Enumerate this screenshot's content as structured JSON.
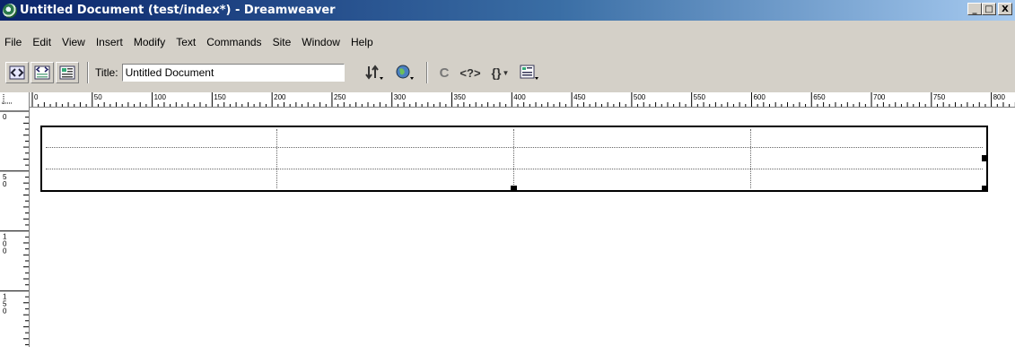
{
  "window": {
    "title": "Untitled Document (test/index*) - Dreamweaver",
    "controls": [
      "_",
      "□",
      "X"
    ]
  },
  "menu": [
    "File",
    "Edit",
    "View",
    "Insert",
    "Modify",
    "Text",
    "Commands",
    "Site",
    "Window",
    "Help"
  ],
  "toolbar": {
    "title_label": "Title:",
    "title_value": "Untitled Document",
    "icons": [
      "code-view-icon",
      "split-view-icon",
      "design-view-icon",
      "file-management-icon",
      "preview-in-browser-icon",
      "refresh-icon",
      "reference-icon",
      "code-navigation-icon",
      "view-options-icon"
    ],
    "refresh_glyph": "C",
    "reference_glyph": "<?>",
    "code_nav_glyph": "{}"
  },
  "rulers": {
    "horizontal_labels": [
      "0",
      "50",
      "100",
      "150",
      "200",
      "250",
      "300",
      "350",
      "400",
      "450",
      "500",
      "550",
      "600",
      "650",
      "700",
      "750",
      "800"
    ],
    "vertical_labels": [
      "0",
      "50",
      "100",
      "150"
    ]
  }
}
